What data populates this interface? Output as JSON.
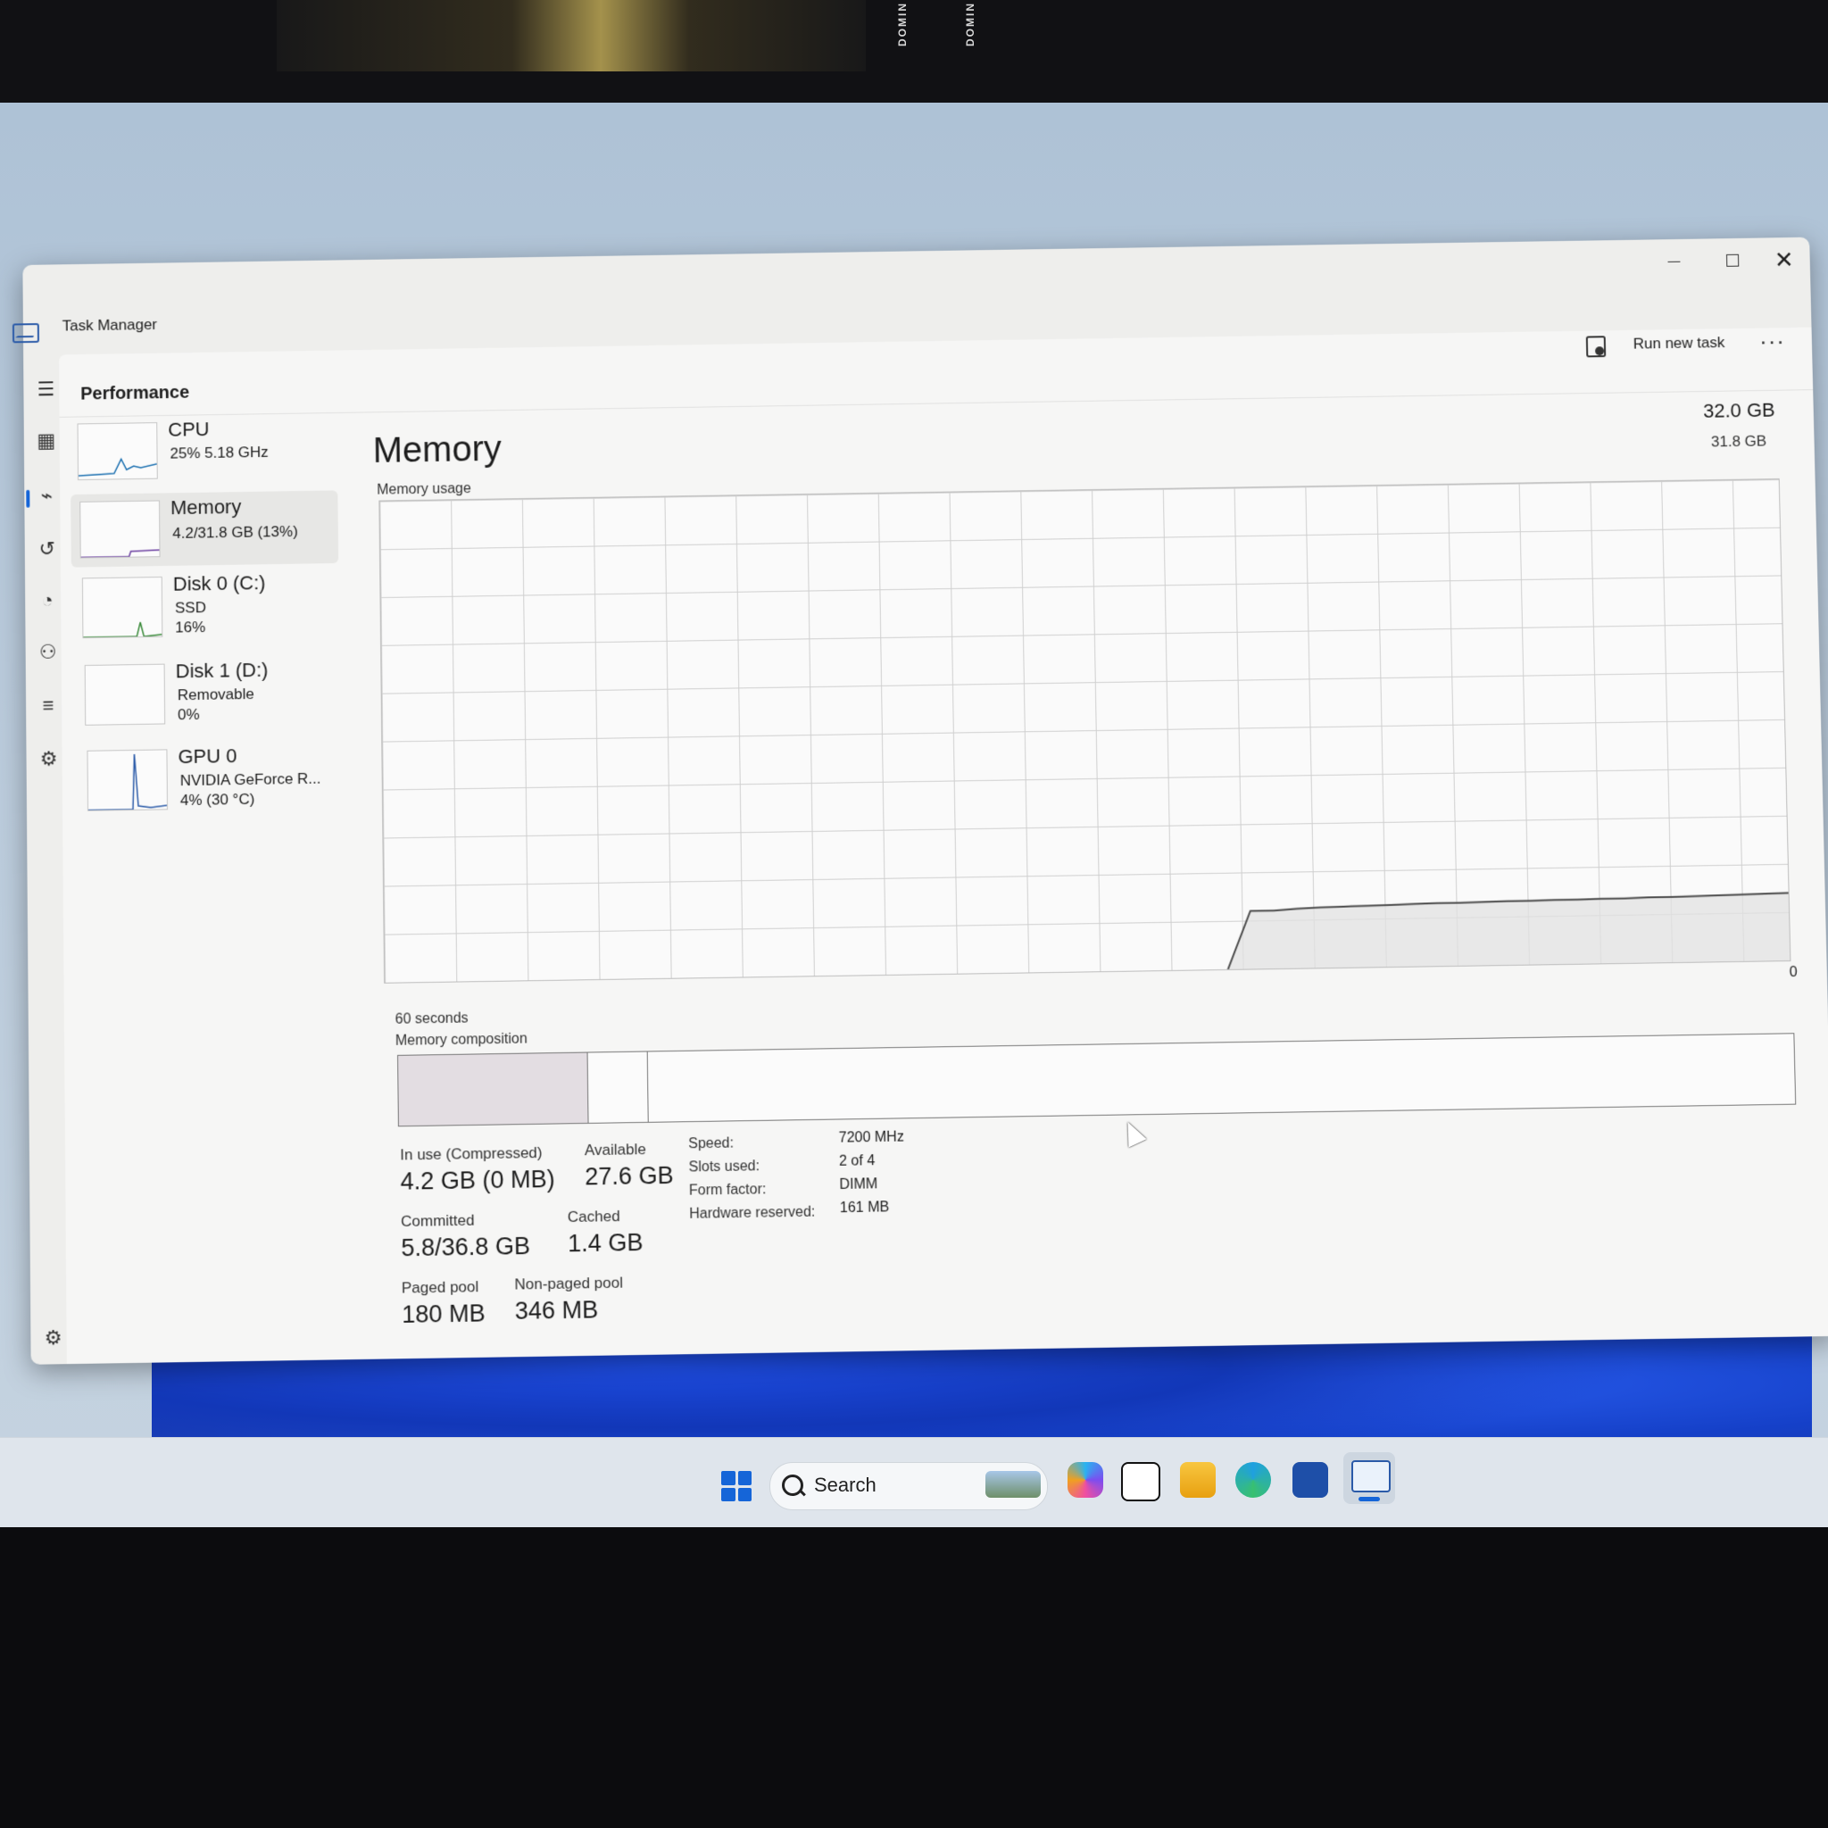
{
  "window": {
    "title": "Task Manager",
    "buttons": {
      "minimize": "",
      "maximize": "",
      "close": "✕"
    }
  },
  "header": {
    "section": "Performance",
    "run_new_task": "Run new task",
    "more": "···"
  },
  "rail": {
    "icons": [
      "hamburger-menu-icon",
      "processes-icon",
      "performance-icon",
      "app-history-icon",
      "startup-apps-icon",
      "users-icon",
      "details-icon",
      "services-icon"
    ],
    "active": "performance-icon"
  },
  "devices": [
    {
      "name": "CPU",
      "lines": [
        "25%  5.18 GHz"
      ]
    },
    {
      "name": "Memory",
      "lines": [
        "4.2/31.8 GB (13%)"
      ],
      "selected": true
    },
    {
      "name": "Disk 0 (C:)",
      "lines": [
        "SSD",
        "16%"
      ]
    },
    {
      "name": "Disk 1 (D:)",
      "lines": [
        "Removable",
        "0%"
      ]
    },
    {
      "name": "GPU 0",
      "lines": [
        "NVIDIA GeForce R...",
        "4% (30 °C)"
      ]
    }
  ],
  "memory": {
    "title": "Memory",
    "total": "32.0 GB",
    "usage_label": "Memory usage",
    "max": "31.8 GB",
    "axis_zero": "0",
    "time_span": "60 seconds",
    "composition_label": "Memory composition",
    "composition": {
      "in_use_fraction": 0.135,
      "modified_fraction": 0.043
    },
    "usage_history": [
      0,
      0,
      0,
      0,
      0,
      0,
      0,
      0,
      0,
      0,
      0,
      0,
      0,
      0,
      0,
      0,
      0,
      0,
      0,
      0,
      0,
      0,
      0,
      0,
      0,
      0,
      0,
      0,
      0,
      0,
      0,
      0,
      0,
      0,
      0,
      0,
      0,
      12,
      12,
      12.3,
      12.5,
      12.6,
      12.7,
      12.8,
      12.9,
      13,
      13,
      13.1,
      13.2,
      13.2,
      13.3,
      13.3,
      13.4,
      13.4,
      13.5,
      13.5,
      13.6,
      13.7,
      13.8,
      13.9,
      14
    ],
    "stats": {
      "in_use_label": "In use (Compressed)",
      "in_use_value": "4.2 GB (0 MB)",
      "available_label": "Available",
      "available_value": "27.6 GB",
      "committed_label": "Committed",
      "committed_value": "5.8/36.8 GB",
      "cached_label": "Cached",
      "cached_value": "1.4 GB",
      "paged_label": "Paged pool",
      "paged_value": "180 MB",
      "nonpaged_label": "Non-paged pool",
      "nonpaged_value": "346 MB"
    },
    "specs": [
      {
        "key": "Speed:",
        "value": "7200 MHz"
      },
      {
        "key": "Slots used:",
        "value": "2 of 4"
      },
      {
        "key": "Form factor:",
        "value": "DIMM"
      },
      {
        "key": "Hardware reserved:",
        "value": "161 MB"
      }
    ]
  },
  "taskbar": {
    "search_label": "Search",
    "apps": [
      "windows-start-icon",
      "copilot-icon",
      "task-view-icon",
      "file-explorer-icon",
      "edge-icon",
      "microsoft-store-icon",
      "task-manager-icon"
    ]
  },
  "photo_text": {
    "left": "DOMIN",
    "right": "DOMIN"
  },
  "colors": {
    "accent": "#1565d8",
    "graph_line": "#4a4a4a",
    "graph_fill": "#e2e2e2",
    "inuse_fill": "#e3dde2"
  }
}
